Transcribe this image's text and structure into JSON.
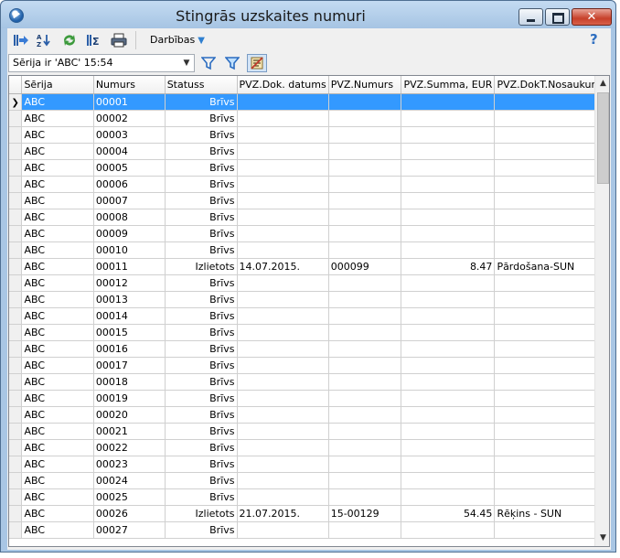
{
  "window": {
    "title": "Stingrās uzskaites numuri",
    "close_glyph": "✕"
  },
  "toolbar": {
    "actions_label": "Darbības",
    "help_glyph": "?"
  },
  "filter": {
    "combo_value": "Sērija ir 'ABC' 15:54"
  },
  "grid": {
    "columns": [
      "Sērija",
      "Numurs",
      "Statuss",
      "PVZ.Dok. datums",
      "PVZ.Numurs",
      "PVZ.Summa, EUR",
      "PVZ.DokT.Nosaukums"
    ],
    "rows": [
      [
        "ABC",
        "00001",
        "Brīvs",
        "",
        "",
        "",
        ""
      ],
      [
        "ABC",
        "00002",
        "Brīvs",
        "",
        "",
        "",
        ""
      ],
      [
        "ABC",
        "00003",
        "Brīvs",
        "",
        "",
        "",
        ""
      ],
      [
        "ABC",
        "00004",
        "Brīvs",
        "",
        "",
        "",
        ""
      ],
      [
        "ABC",
        "00005",
        "Brīvs",
        "",
        "",
        "",
        ""
      ],
      [
        "ABC",
        "00006",
        "Brīvs",
        "",
        "",
        "",
        ""
      ],
      [
        "ABC",
        "00007",
        "Brīvs",
        "",
        "",
        "",
        ""
      ],
      [
        "ABC",
        "00008",
        "Brīvs",
        "",
        "",
        "",
        ""
      ],
      [
        "ABC",
        "00009",
        "Brīvs",
        "",
        "",
        "",
        ""
      ],
      [
        "ABC",
        "00010",
        "Brīvs",
        "",
        "",
        "",
        ""
      ],
      [
        "ABC",
        "00011",
        "Izlietots",
        "14.07.2015.",
        "000099",
        "8.47",
        "Pārdošana-SUN"
      ],
      [
        "ABC",
        "00012",
        "Brīvs",
        "",
        "",
        "",
        ""
      ],
      [
        "ABC",
        "00013",
        "Brīvs",
        "",
        "",
        "",
        ""
      ],
      [
        "ABC",
        "00014",
        "Brīvs",
        "",
        "",
        "",
        ""
      ],
      [
        "ABC",
        "00015",
        "Brīvs",
        "",
        "",
        "",
        ""
      ],
      [
        "ABC",
        "00016",
        "Brīvs",
        "",
        "",
        "",
        ""
      ],
      [
        "ABC",
        "00017",
        "Brīvs",
        "",
        "",
        "",
        ""
      ],
      [
        "ABC",
        "00018",
        "Brīvs",
        "",
        "",
        "",
        ""
      ],
      [
        "ABC",
        "00019",
        "Brīvs",
        "",
        "",
        "",
        ""
      ],
      [
        "ABC",
        "00020",
        "Brīvs",
        "",
        "",
        "",
        ""
      ],
      [
        "ABC",
        "00021",
        "Brīvs",
        "",
        "",
        "",
        ""
      ],
      [
        "ABC",
        "00022",
        "Brīvs",
        "",
        "",
        "",
        ""
      ],
      [
        "ABC",
        "00023",
        "Brīvs",
        "",
        "",
        "",
        ""
      ],
      [
        "ABC",
        "00024",
        "Brīvs",
        "",
        "",
        "",
        ""
      ],
      [
        "ABC",
        "00025",
        "Brīvs",
        "",
        "",
        "",
        ""
      ],
      [
        "ABC",
        "00026",
        "Izlietots",
        "21.07.2015.",
        "15-00129",
        "54.45",
        "Rēķins - SUN"
      ],
      [
        "ABC",
        "00027",
        "Brīvs",
        "",
        "",
        "",
        ""
      ]
    ],
    "selected_row": 0
  },
  "icons": {
    "app": "app-globe-icon",
    "toolbar": [
      "export-icon",
      "sort-az-icon",
      "refresh-icon",
      "sum-icon",
      "print-icon"
    ],
    "filter": [
      "filter-icon",
      "filter-edit-icon",
      "clear-filter-icon"
    ]
  },
  "colors": {
    "selection": "#3399ff",
    "title_bar": "#a9c6e4",
    "close_button": "#c7402a"
  }
}
